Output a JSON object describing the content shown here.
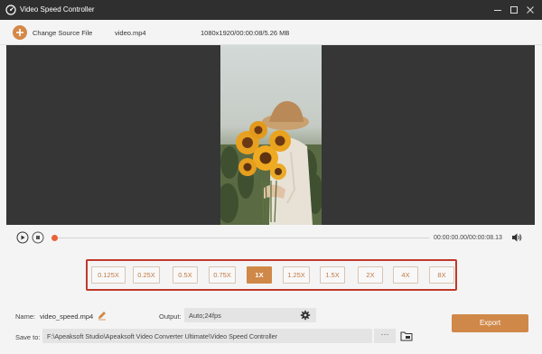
{
  "window": {
    "title": "Video Speed Controller"
  },
  "toolbar": {
    "change_source_label": "Change Source File",
    "file_name": "video.mp4",
    "file_info": "1080x1920/00:00:08/5.26 MB"
  },
  "player": {
    "timecode": "00:00:00.00/00:00:08.13",
    "progress": 0.0
  },
  "speeds": {
    "options": [
      "0.125X",
      "0.25X",
      "0.5X",
      "0.75X",
      "1X",
      "1.25X",
      "1.5X",
      "2X",
      "4X",
      "8X"
    ],
    "selected": "1X"
  },
  "output_panel": {
    "name_label": "Name:",
    "name_value": "video_speed.mp4",
    "output_label": "Output:",
    "output_value": "Auto;24fps",
    "save_label": "Save to:",
    "save_path": "F:\\Apeaksoft Studio\\Apeaksoft Video Converter Ultimate\\Video Speed Controller",
    "browse_label": "···",
    "export_label": "Export"
  },
  "colors": {
    "accent": "#d08848",
    "highlight_border": "#c0392b",
    "playhead": "#e8623c",
    "titlebar": "#2f2f2f"
  },
  "icons": [
    "app-logo-icon",
    "minimize-icon",
    "maximize-icon",
    "close-icon",
    "plus-icon",
    "play-icon",
    "stop-icon",
    "volume-icon",
    "edit-icon",
    "gear-icon",
    "folder-icon"
  ]
}
